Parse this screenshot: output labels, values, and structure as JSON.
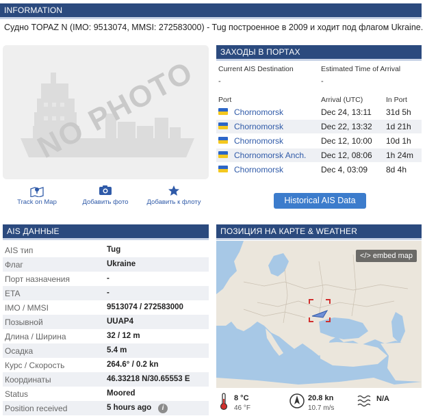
{
  "sections": {
    "information": "INFORMATION",
    "port_calls": "ЗАХОДЫ В ПОРТАХ",
    "ais": "AIS ДАННЫЕ",
    "map": "ПОЗИЦИЯ НА КАРТЕ & WEATHER"
  },
  "intro": "Судно TOPAZ N (IMO: 9513074, MMSI: 272583000) - Tug построенное в 2009 и ходит под флагом Ukraine.",
  "photo": {
    "placeholder": "NO PHOTO"
  },
  "actions": [
    {
      "label": "Track on Map",
      "icon": "map-pin-icon"
    },
    {
      "label": "Добавить фото",
      "icon": "camera-icon"
    },
    {
      "label": "Добавить к флоту",
      "icon": "star-icon"
    }
  ],
  "port_calls": {
    "dest_label": "Current AIS Destination",
    "eta_label": "Estimated Time of Arrival",
    "dest_value": "-",
    "eta_value": "-",
    "columns": {
      "port": "Port",
      "arrival": "Arrival (UTC)",
      "in_port": "In Port"
    },
    "rows": [
      {
        "port": "Chornomorsk",
        "arrival": "Dec 24, 13:11",
        "in_port": "31d 5h"
      },
      {
        "port": "Chornomorsk",
        "arrival": "Dec 22, 13:32",
        "in_port": "1d 21h"
      },
      {
        "port": "Chornomorsk",
        "arrival": "Dec 12, 10:00",
        "in_port": "10d 1h"
      },
      {
        "port": "Chornomorsk Anch.",
        "arrival": "Dec 12, 08:06",
        "in_port": "1h 24m"
      },
      {
        "port": "Chornomorsk",
        "arrival": "Dec 4, 03:09",
        "in_port": "8d 4h"
      }
    ],
    "history_button": "Historical AIS Data"
  },
  "ais": [
    {
      "key": "AIS тип",
      "value": "Tug"
    },
    {
      "key": "Флаг",
      "value": "Ukraine"
    },
    {
      "key": "Порт назначения",
      "value": "-"
    },
    {
      "key": "ETA",
      "value": "-"
    },
    {
      "key": "IMO / MMSI",
      "value": "9513074 / 272583000"
    },
    {
      "key": "Позывной",
      "value": "UUAP4"
    },
    {
      "key": "Длина / Ширина",
      "value": "32 / 12 m"
    },
    {
      "key": "Осадка",
      "value": "5.4 m"
    },
    {
      "key": "Курс / Скорость",
      "value": "264.6° / 0.2 kn"
    },
    {
      "key": "Координаты",
      "value": "46.33218 N/30.65553 E"
    },
    {
      "key": "Status",
      "value": "Moored"
    },
    {
      "key": "Position received",
      "value": "5 hours ago"
    }
  ],
  "map": {
    "embed_label": "</> embed map",
    "info_glyph": "i"
  },
  "weather": {
    "temp_c": "8 °C",
    "temp_f": "46 °F",
    "wind_kn": "20.8 kn",
    "wind_ms": "10.7 m/s",
    "waves": "N/A"
  },
  "colors": {
    "header": "#2b4a7e",
    "link": "#2f5aa8",
    "button": "#3c7ccc",
    "sea": "#a7c8e6",
    "land": "#ebe6dc"
  }
}
